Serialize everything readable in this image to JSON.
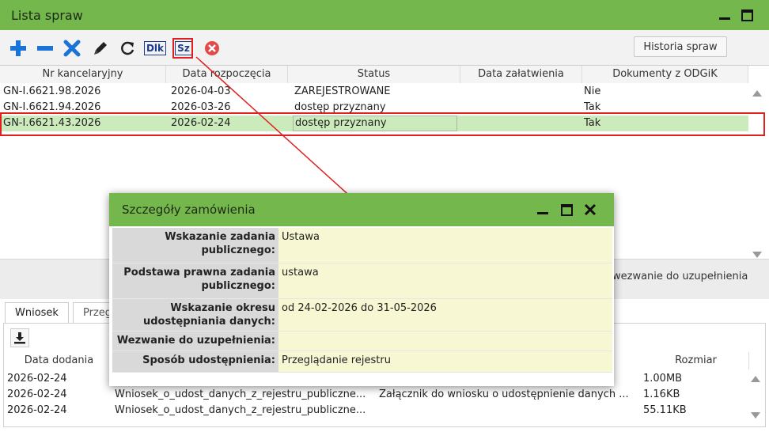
{
  "window": {
    "title": "Lista spraw"
  },
  "toolbar": {
    "history_label": "Historia spraw",
    "dlk_label": "Dlk",
    "sz_label": "Sz"
  },
  "cases_table": {
    "columns": [
      "Nr kancelaryjny",
      "Data rozpoczęcia",
      "Status",
      "Data załatwienia",
      "Dokumenty z ODGiK"
    ],
    "rows": [
      [
        "GN-I.6621.98.2026",
        "2026-04-03",
        "ZAREJESTROWANE",
        "",
        "Nie"
      ],
      [
        "GN-I.6621.94.2026",
        "2026-03-26",
        "dostęp przyznany",
        "",
        "Tak"
      ],
      [
        "GN-I.6621.43.2026",
        "2026-02-24",
        "dostęp przyznany",
        "",
        "Tak"
      ]
    ]
  },
  "behind_strip_text": "wezwanie do uzupełnienia",
  "tabs": {
    "wniosek": "Wniosek",
    "second_partial": "Przeg"
  },
  "files_table": {
    "columns": [
      "Data dodania",
      "Rozmiar"
    ],
    "rows": [
      [
        "2026-02-24",
        "",
        "",
        "1.00MB"
      ],
      [
        "2026-02-24",
        "Wniosek_o_udost_danych_z_rejestru_publiczne...",
        "Załącznik do wniosku o udostępnienie danych ...",
        "1.16KB"
      ],
      [
        "2026-02-24",
        "Wniosek_o_udost_danych_z_rejestru_publiczne...",
        "",
        "55.11KB"
      ]
    ]
  },
  "modal": {
    "title": "Szczegóły zamówienia",
    "fields": [
      {
        "label": "Wskazanie zadania publicznego:",
        "value": "Ustawa"
      },
      {
        "label": "Podstawa prawna zadania publicznego:",
        "value": "ustawa"
      },
      {
        "label": "Wskazanie okresu udostępniania danych:",
        "value": "od 24-02-2026 do 31-05-2026"
      },
      {
        "label": "Wezwanie do uzupełnienia:",
        "value": ""
      },
      {
        "label": "Sposób udostępnienia:",
        "value": "Przeglądanie rejestru"
      }
    ]
  },
  "colors": {
    "accent_green": "#74b84d",
    "selection": "#ccebbd",
    "highlight_red": "#e02020",
    "modal_value_bg": "#f7f8d3"
  }
}
